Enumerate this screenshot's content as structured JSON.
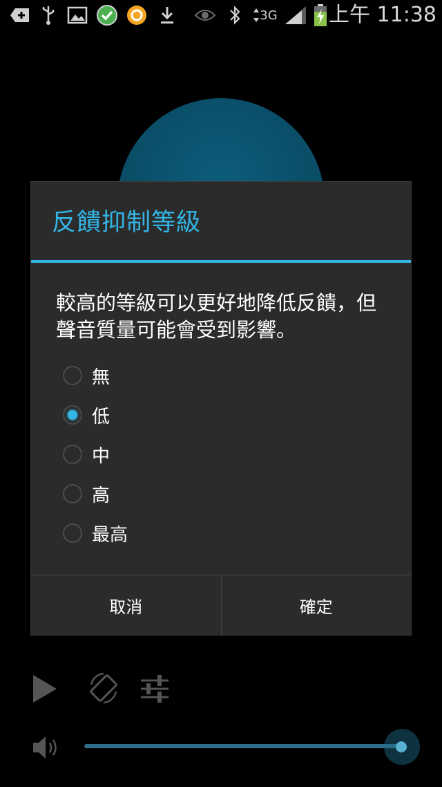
{
  "status_bar": {
    "network": "3G",
    "time": "上午 11:38",
    "icons": [
      "add-icon",
      "usb-icon",
      "image-icon",
      "check-circle-icon",
      "app-icon",
      "download-icon",
      "eye-icon",
      "bluetooth-icon",
      "data-arrows-icon",
      "signal-icon",
      "battery-charging-icon"
    ]
  },
  "dialog": {
    "title": "反饋抑制等級",
    "message": "較高的等級可以更好地降低反饋，但聲音質量可能會受到影響。",
    "options": [
      {
        "label": "無",
        "checked": false
      },
      {
        "label": "低",
        "checked": true
      },
      {
        "label": "中",
        "checked": false
      },
      {
        "label": "高",
        "checked": false
      },
      {
        "label": "最高",
        "checked": false
      }
    ],
    "cancel_label": "取消",
    "ok_label": "確定"
  },
  "controls": {
    "icons": [
      "play-icon",
      "rotate-icon",
      "equalizer-icon",
      "volume-icon"
    ],
    "volume_level": 1.0
  },
  "colors": {
    "accent": "#33b5e5",
    "dialog_bg": "#2b2b2b"
  }
}
